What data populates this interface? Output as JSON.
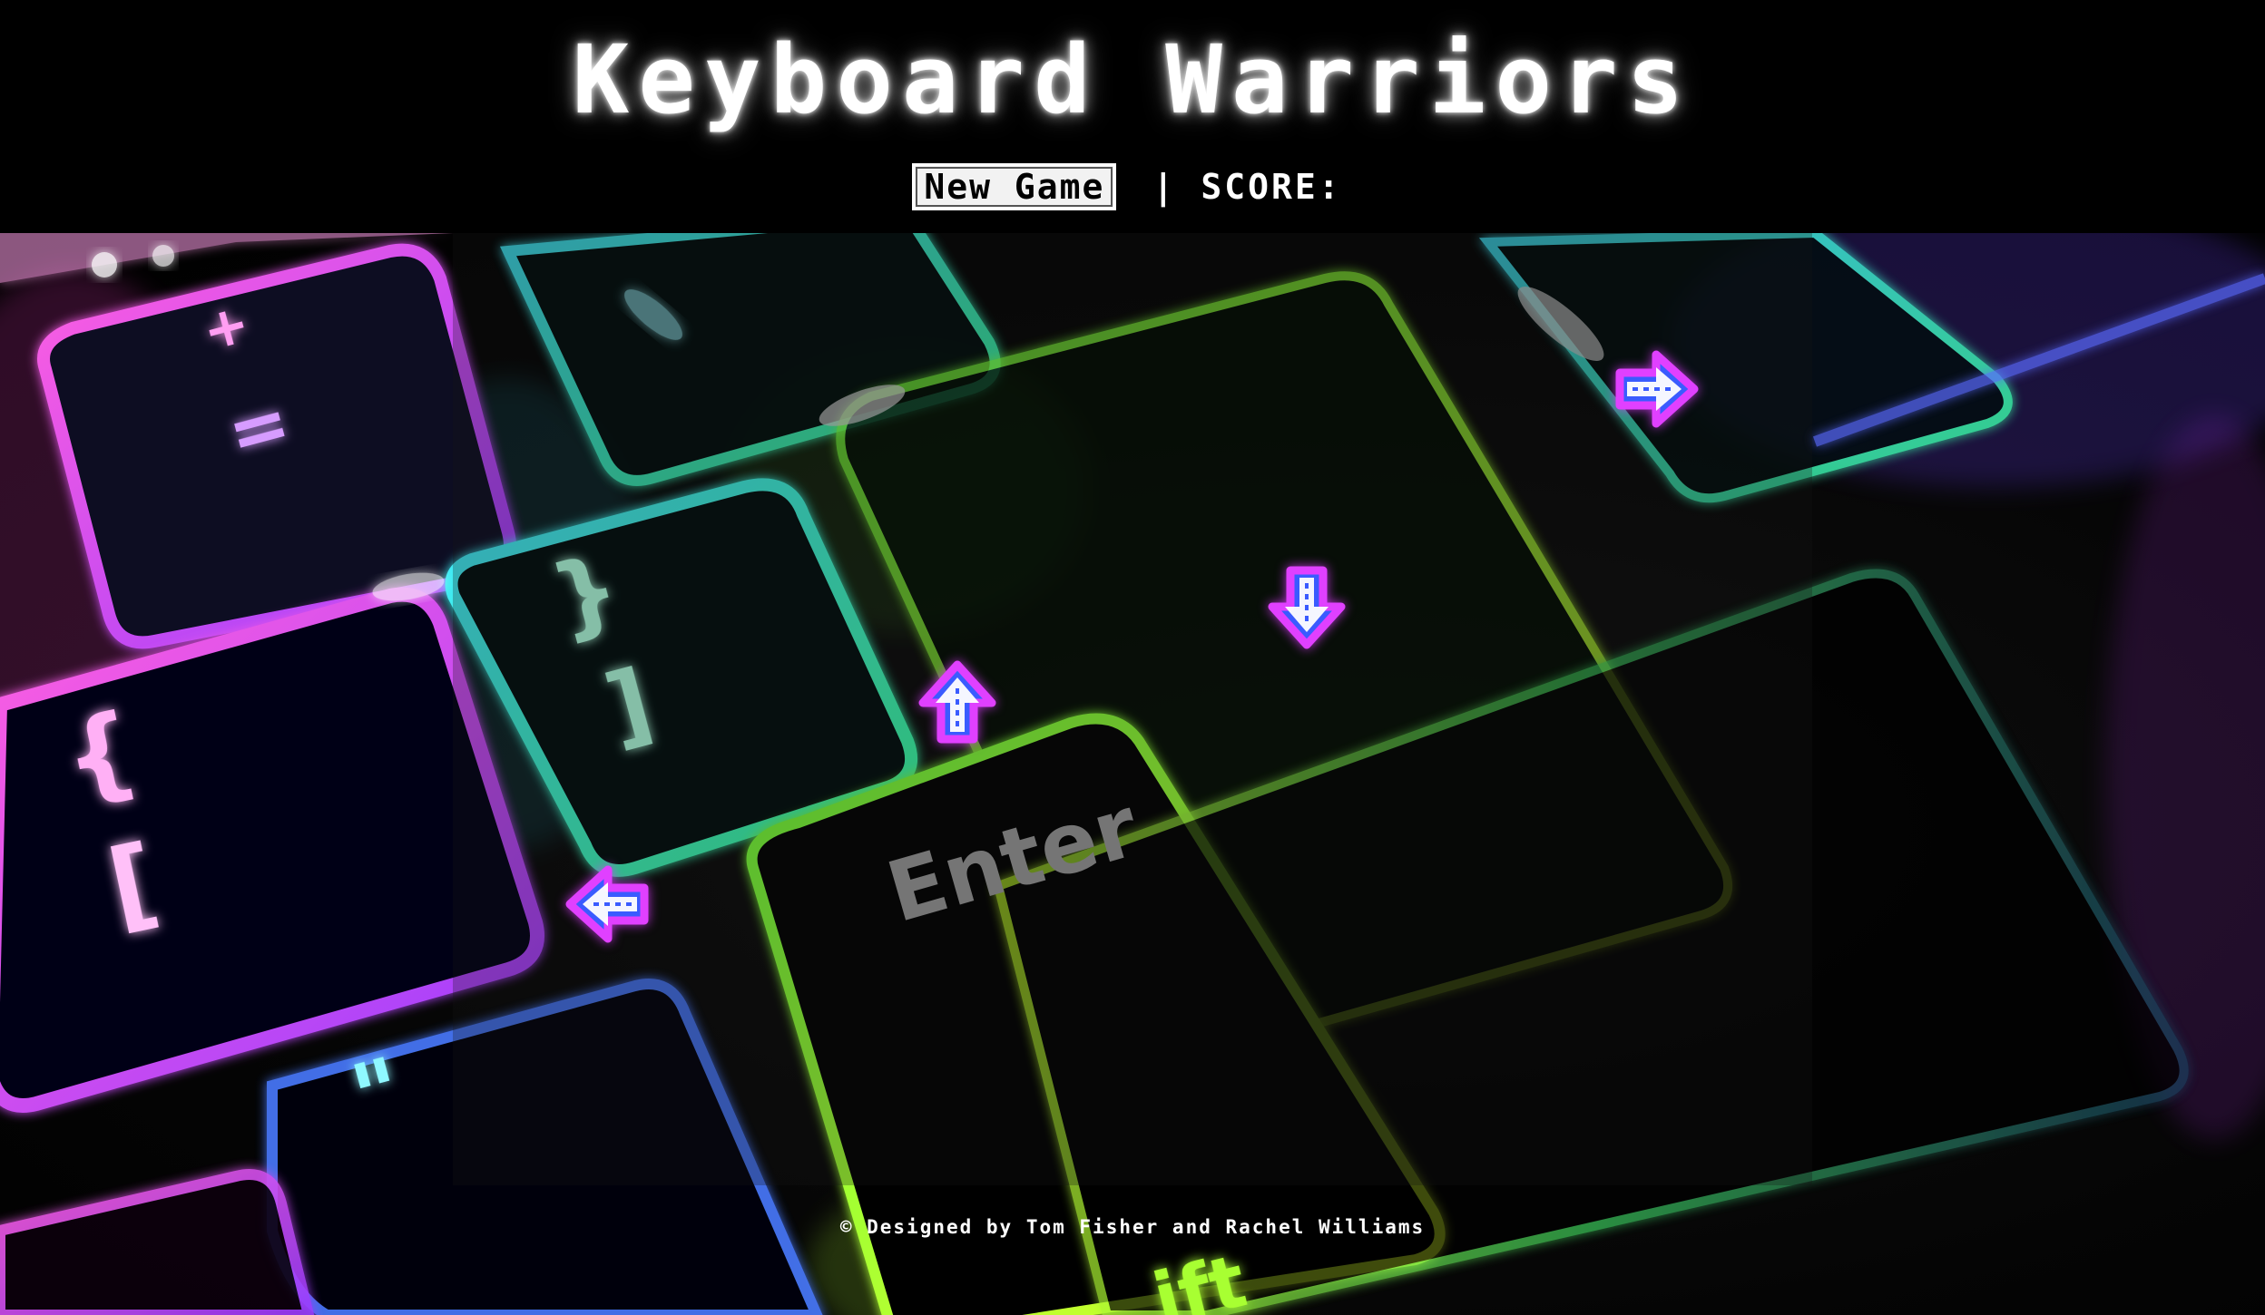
{
  "header": {
    "title": "Keyboard Warriors",
    "new_game_label": "New Game",
    "separator": "|",
    "score_label": "SCORE:",
    "score_value": ""
  },
  "keyboard": {
    "key_labels": [
      "+",
      "=",
      "{",
      "[",
      "}",
      "]",
      "Enter",
      "\""
    ]
  },
  "arrows": [
    {
      "direction": "right",
      "icon": "arrow-right-icon"
    },
    {
      "direction": "down",
      "icon": "arrow-down-icon"
    },
    {
      "direction": "up",
      "icon": "arrow-up-icon"
    },
    {
      "direction": "left",
      "icon": "arrow-left-icon"
    }
  ],
  "colors": {
    "arrow_outline": "#e040ff",
    "arrow_fill": "#3a5bff",
    "arrow_core": "#ffffff",
    "glow_pink": "#ff3fd8",
    "glow_cyan": "#40e8ff",
    "glow_green": "#7dff3a",
    "glow_yellow": "#d8ff2a"
  },
  "footer": {
    "text": "© Designed by Tom Fisher and Rachel Williams"
  }
}
